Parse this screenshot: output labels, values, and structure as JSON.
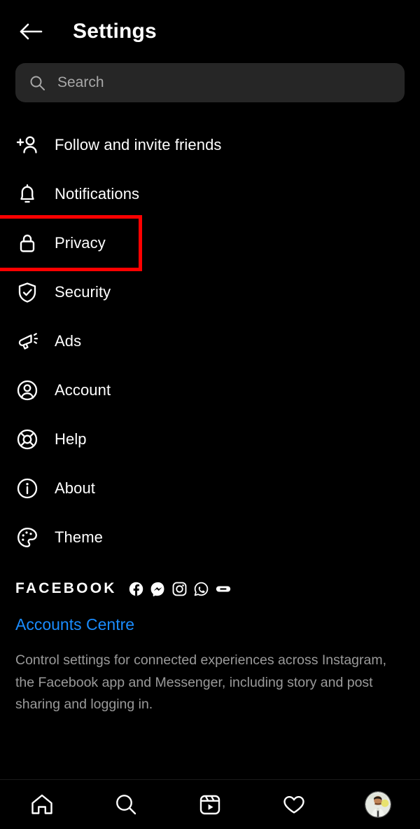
{
  "header": {
    "back_icon": "arrow-left-icon",
    "title": "Settings"
  },
  "search": {
    "icon": "search-icon",
    "placeholder": "Search",
    "value": ""
  },
  "menu": {
    "items": [
      {
        "label": "Follow and invite friends",
        "icon": "person-add-icon",
        "highlighted": false
      },
      {
        "label": "Notifications",
        "icon": "bell-icon",
        "highlighted": false
      },
      {
        "label": "Privacy",
        "icon": "lock-icon",
        "highlighted": true
      },
      {
        "label": "Security",
        "icon": "shield-check-icon",
        "highlighted": false
      },
      {
        "label": "Ads",
        "icon": "megaphone-icon",
        "highlighted": false
      },
      {
        "label": "Account",
        "icon": "account-circle-icon",
        "highlighted": false
      },
      {
        "label": "Help",
        "icon": "lifebuoy-icon",
        "highlighted": false
      },
      {
        "label": "About",
        "icon": "info-circle-icon",
        "highlighted": false
      },
      {
        "label": "Theme",
        "icon": "palette-icon",
        "highlighted": false
      }
    ]
  },
  "facebook_section": {
    "brand": "FACEBOOK",
    "app_icons": [
      "facebook-icon",
      "messenger-icon",
      "instagram-icon",
      "whatsapp-icon",
      "portal-icon"
    ],
    "link": "Accounts Centre",
    "description": "Control settings for connected experiences across Instagram, the Facebook app and Messenger, including story and post sharing and logging in."
  },
  "bottom_nav": {
    "items": [
      {
        "icon": "home-icon",
        "label": "Home"
      },
      {
        "icon": "search-icon",
        "label": "Search"
      },
      {
        "icon": "reels-icon",
        "label": "Reels"
      },
      {
        "icon": "heart-icon",
        "label": "Activity"
      },
      {
        "icon": "profile-avatar",
        "label": "Profile"
      }
    ]
  },
  "colors": {
    "background": "#000000",
    "text_primary": "#ffffff",
    "text_secondary": "#9a9a9a",
    "search_field": "#262626",
    "link": "#1a8cff",
    "highlight": "#ff0000"
  }
}
